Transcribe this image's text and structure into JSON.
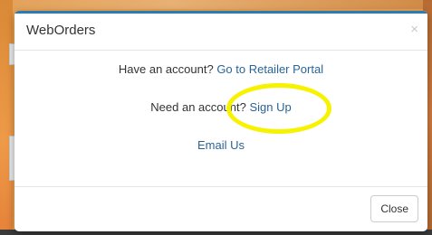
{
  "modal": {
    "title": "WebOrders",
    "close_icon": "×",
    "line1_text": "Have an account?",
    "line1_link": "Go to Retailer Portal",
    "line2_text": "Need an account?",
    "line2_link": "Sign Up",
    "line3_link": "Email Us",
    "close_button": "Close"
  },
  "colors": {
    "link": "#2a6496",
    "accent_bar": "#2b7bb9",
    "highlight": "#f7f200",
    "backdrop": "#e9a24f"
  }
}
